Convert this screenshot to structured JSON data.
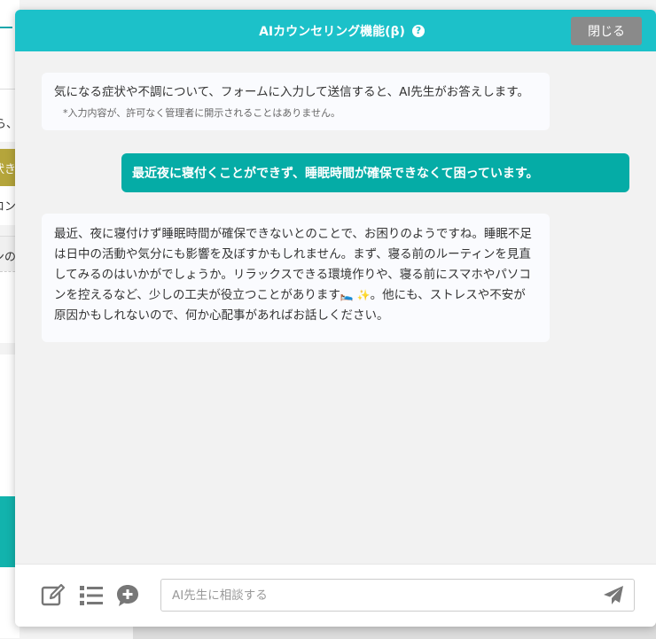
{
  "background": {
    "snippets": [
      "ら、",
      "状き",
      "ロン",
      "ンの"
    ]
  },
  "dialog": {
    "title": "AIカウンセリング機能(β)",
    "help_icon": "question-circle-icon",
    "close_label": "閉じる"
  },
  "messages": {
    "intro_text": "気になる症状や不調について、フォームに入力して送信すると、AI先生がお答えします。",
    "intro_note": "*入力内容が、許可なく管理者に開示されることはありません。",
    "user_text": "最近夜に寝付くことができず、睡眠時間が確保できなくて困っています。",
    "reply_part1": "最近、夜に寝付けず睡眠時間が確保できないとのことで、お困りのようですね。睡眠不足は日中の活動や気分にも影響を及ぼすかもしれません。まず、寝る前のルーティンを見直してみるのはいかがでしょうか。リラックスできる環境作りや、寝る前にスマホやパソコンを控えるなど、少しの工夫が役立つことがあります",
    "reply_emoji": "🛌 ✨",
    "reply_part2": "。他にも、ストレスや不安が原因かもしれないので、何か心配事があればお話しください。"
  },
  "input_bar": {
    "placeholder": "AI先生に相談する",
    "icons": [
      "edit-icon",
      "list-icon",
      "chat-plus-icon",
      "send-icon"
    ]
  },
  "colors": {
    "header": "#1cc1c9",
    "user_bubble": "#05aca6",
    "close_button": "#8a8a8a",
    "icon_gray": "#777777"
  }
}
